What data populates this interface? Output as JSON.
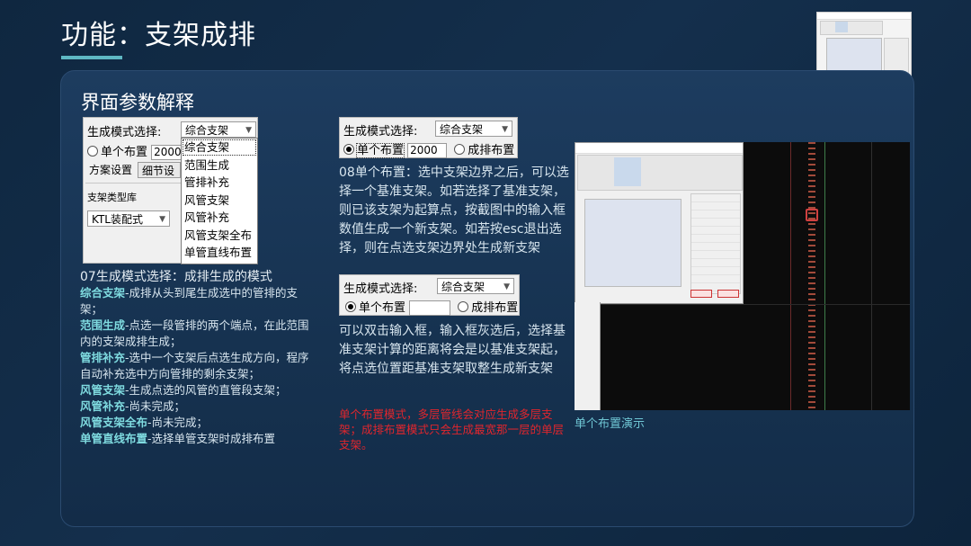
{
  "slide": {
    "title": "功能：支架成排",
    "section_title": "界面参数解释"
  },
  "dialog1": {
    "mode_label": "生成模式选择:",
    "mode_value": "综合支架",
    "single_label": "单个布置",
    "single_value": "2000",
    "plan_button": "方案设置",
    "detail_button": "细节设置",
    "type_lib_label": "支架类型库",
    "type_lib_value": "KTL装配式",
    "dropdown_options": [
      "综合支架",
      "范围生成",
      "管排补充",
      "风管支架",
      "风管补充",
      "风管支架全布",
      "单管直线布置"
    ]
  },
  "text07": {
    "heading": "07生成模式选择：成排生成的模式",
    "items": [
      {
        "term": "综合支架",
        "desc": "-成排从头到尾生成选中的管排的支架；"
      },
      {
        "term": "范围生成",
        "desc": "-点选一段管排的两个端点，在此范围内的支架成排生成；"
      },
      {
        "term": "管排补充",
        "desc": "-选中一个支架后点选生成方向，程序自动补充选中方向管排的剩余支架；"
      },
      {
        "term": "风管支架",
        "desc": "-生成点选的风管的直管段支架；"
      },
      {
        "term": "风管补充",
        "desc": "-尚未完成；"
      },
      {
        "term": "风管支架全布",
        "desc": "-尚未完成；"
      },
      {
        "term": "单管直线布置",
        "desc": "-选择单管支架时成排布置"
      }
    ]
  },
  "dialog2": {
    "mode_label": "生成模式选择:",
    "mode_value": "综合支架",
    "single_label": "单个布置",
    "single_value": "2000",
    "row_label": "成排布置"
  },
  "text08": "08单个布置：选中支架边界之后，可以选择一个基准支架。如若选择了基准支架，则已该支架为起算点，按截图中的输入框数值生成一个新支架。如若按esc退出选择，则在点选支架边界处生成新支架",
  "dialog3": {
    "mode_label": "生成模式选择:",
    "mode_value": "综合支架",
    "single_label": "单个布置",
    "single_value": "",
    "row_label": "成排布置"
  },
  "text_dbl": "可以双击输入框，输入框灰选后，选择基准支架计算的距离将会是以基准支架起，将点选位置距基准支架取整生成新支架",
  "text_red": "单个布置模式，多层管线会对应生成多层支架；成排布置模式只会生成最宽那一层的单层支架。",
  "demo_caption": "单个布置演示",
  "colors": {
    "accent": "#5fb8c3",
    "highlight": "#7fdbe0",
    "caption": "#6fc6d4",
    "warning": "#e0262d"
  }
}
